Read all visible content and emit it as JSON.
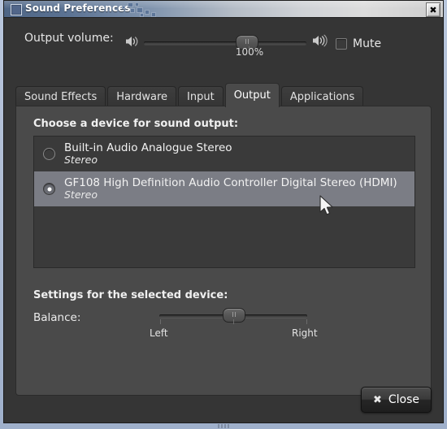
{
  "window": {
    "title": "Sound Preferences",
    "title_icon": "window-app-icon",
    "close_icon": "✖"
  },
  "volume": {
    "label": "Output volume:",
    "value_text": "100%",
    "percent": 65,
    "low_icon": "speaker-low-icon",
    "high_icon": "speaker-high-icon",
    "mute_label": "Mute",
    "mute_checked": false
  },
  "tabs": [
    {
      "label": "Sound Effects",
      "active": false
    },
    {
      "label": "Hardware",
      "active": false
    },
    {
      "label": "Input",
      "active": false
    },
    {
      "label": "Output",
      "active": true
    },
    {
      "label": "Applications",
      "active": false
    }
  ],
  "output_tab": {
    "choose_label": "Choose a device for sound output:",
    "devices": [
      {
        "name": "Built-in Audio Analogue Stereo",
        "sub": "Stereo",
        "selected": false
      },
      {
        "name": "GF108 High Definition Audio Controller Digital Stereo (HDMI)",
        "sub": "Stereo",
        "selected": true
      }
    ],
    "settings_label": "Settings for the selected device:",
    "balance_label": "Balance:",
    "balance_left": "Left",
    "balance_right": "Right",
    "balance_percent": 50
  },
  "footer": {
    "close_label": "Close",
    "close_icon": "✖"
  },
  "colors": {
    "dialog_bg": "#353535",
    "panel_bg": "#4a4a4a",
    "list_bg": "#3a3a3a",
    "selection": "#7b7d85",
    "frame": "#aebbd2",
    "text": "#f0f0f0"
  }
}
